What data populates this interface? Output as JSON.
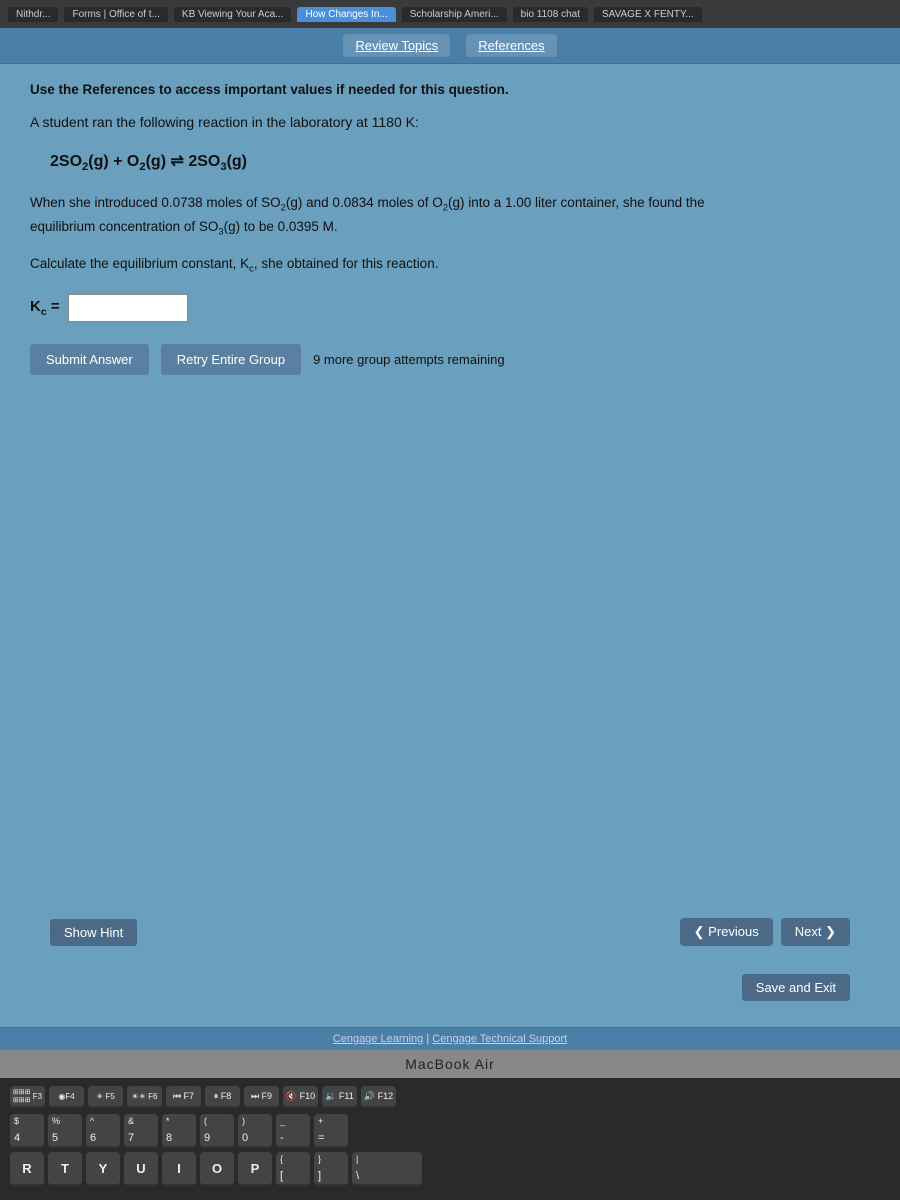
{
  "browser": {
    "tabs": [
      {
        "label": "Nithdr...",
        "active": false
      },
      {
        "label": "Forms | Office of t...",
        "active": false
      },
      {
        "label": "KB Viewing Your Aca...",
        "active": false
      },
      {
        "label": "How Changes In...",
        "active": false
      },
      {
        "label": "Scholarship Ameri...",
        "active": false
      },
      {
        "label": "bio 1108 chat",
        "active": false
      },
      {
        "label": "SAVAGE X FENTY...",
        "active": false
      }
    ]
  },
  "header": {
    "review_topics_tab": "Review Topics",
    "references_tab": "References",
    "references_note": "Use the References to access important values if needed for this question."
  },
  "question": {
    "intro": "A student ran the following reaction in the laboratory at 1180 K:",
    "reaction": "2SO₂(g) + O₂(g) ⇌ 2SO₃(g)",
    "problem_line1": "When she introduced 0.0738 moles of SO₂(g) and 0.0834 moles of O₂(g) into a 1.00 liter container, she found the",
    "problem_line2": "equilibrium concentration of SO₃(g) to be 0.0395 M.",
    "calculate_text": "Calculate the equilibrium constant, Kc, she obtained for this reaction.",
    "kc_label": "Kc =",
    "kc_input_value": "",
    "kc_input_placeholder": ""
  },
  "buttons": {
    "submit_label": "Submit Answer",
    "retry_label": "Retry Entire Group",
    "attempts_text": "9 more group attempts remaining"
  },
  "navigation": {
    "hint_label": "Show Hint",
    "previous_label": "Previous",
    "next_label": "Next",
    "save_exit_label": "Save and Exit"
  },
  "footer": {
    "cengage_learning": "Cengage Learning",
    "separator": "|",
    "cengage_support": "Cengage Technical Support"
  },
  "macbook": {
    "label": "MacBook Air"
  },
  "keyboard": {
    "fn_row": [
      "F3",
      "F4",
      "F5",
      "F6",
      "F7",
      "F8",
      "F9",
      "F10",
      "F11",
      "F12"
    ],
    "row1": [
      "4/$",
      "5/%",
      "6/^",
      "7/&",
      "8/*",
      "9/(",
      "0/)",
      "- ",
      "= /+"
    ],
    "row2_letters": [
      "R",
      "T",
      "Y",
      "U",
      "I",
      "O",
      "P"
    ],
    "row2_symbols": [
      "{/[",
      "}/]"
    ]
  }
}
